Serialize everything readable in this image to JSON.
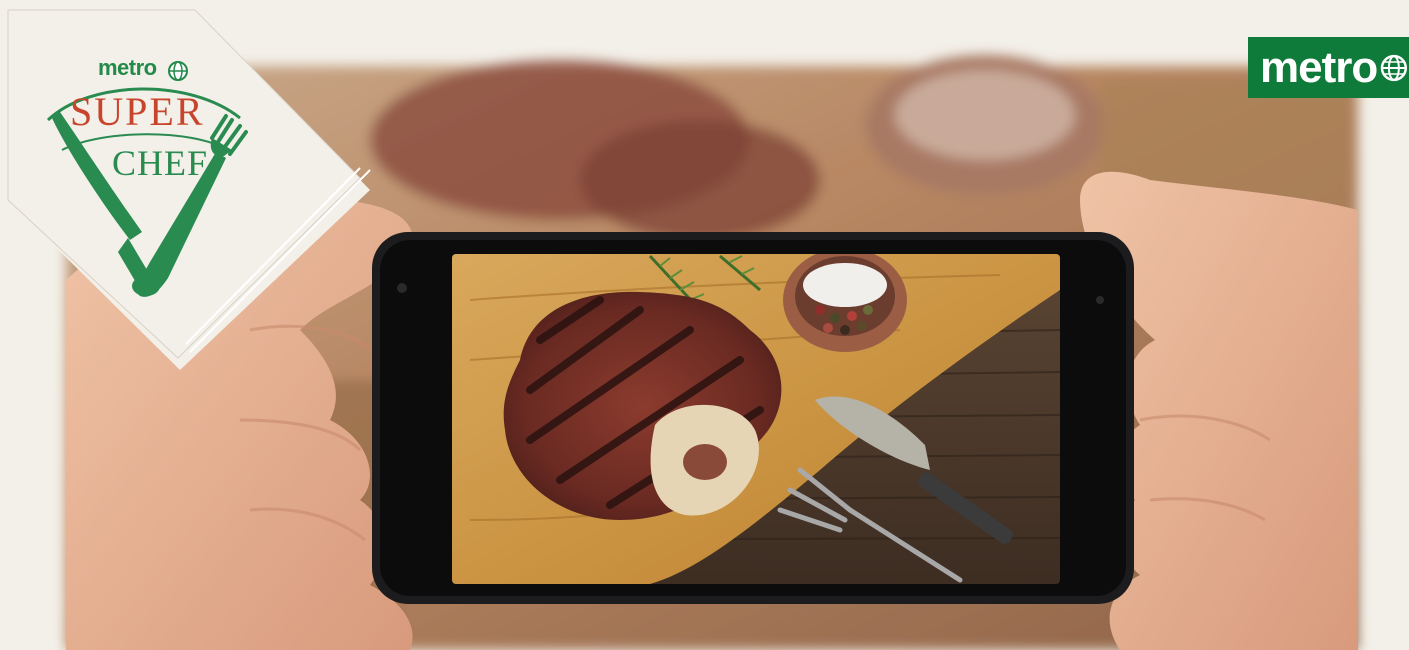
{
  "branding": {
    "corner_logo": {
      "brand": "metro",
      "line1": "SUPER",
      "line2": "CHEF"
    },
    "badge": {
      "brand": "metro"
    }
  },
  "colors": {
    "brand_green": "#0f7b3a",
    "logo_red": "#c8452d",
    "logo_green": "#2a8b50",
    "background": "#f3f0e9"
  },
  "icons": [
    "globe-icon",
    "knife-icon",
    "fork-icon"
  ]
}
